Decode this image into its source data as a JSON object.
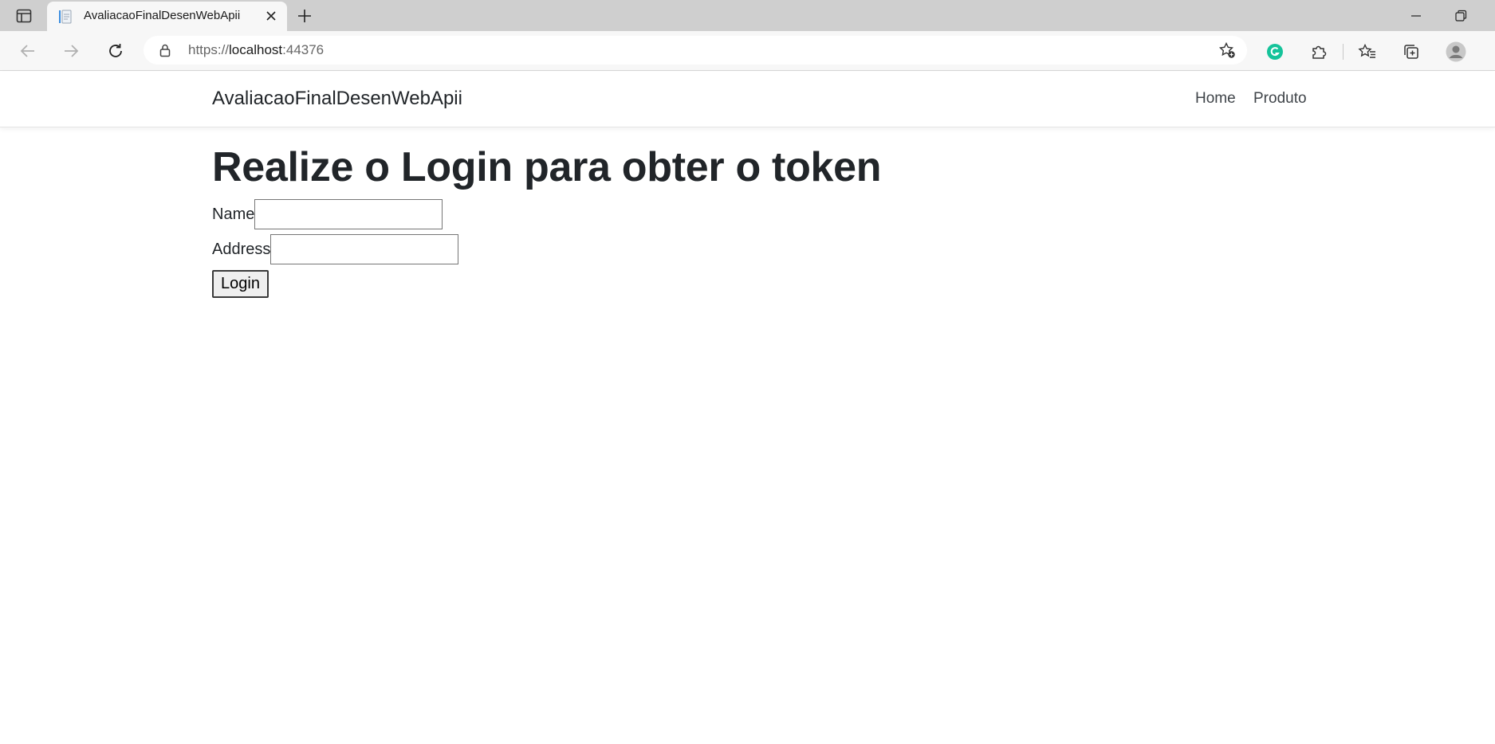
{
  "browser": {
    "tab_title": "AvaliacaoFinalDesenWebApii",
    "url_scheme": "https://",
    "url_host": "localhost",
    "url_port": ":44376",
    "icons": [
      "sidebar-toggle-icon",
      "favicon-icon",
      "close-icon",
      "plus-icon",
      "minimize-icon",
      "restore-icon",
      "back-arrow-icon",
      "forward-arrow-icon",
      "reload-icon",
      "lock-icon",
      "add-favorite-icon",
      "grammarly-icon",
      "puzzle-icon",
      "favorites-icon",
      "collections-icon",
      "profile-icon"
    ]
  },
  "site": {
    "brand": "AvaliacaoFinalDesenWebApii",
    "nav": {
      "home": "Home",
      "produto": "Produto"
    }
  },
  "main": {
    "title": "Realize o Login para obter o token",
    "form": {
      "name_label": "Name",
      "name_value": "",
      "address_label": "Address",
      "address_value": "",
      "submit_label": "Login"
    }
  },
  "colors": {
    "grammarly": "#15c39a",
    "text": "#212529"
  }
}
